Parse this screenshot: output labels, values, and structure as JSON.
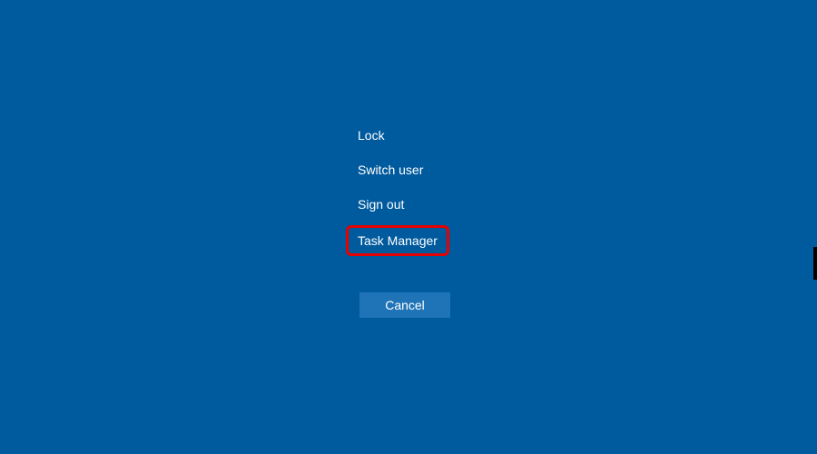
{
  "menu": {
    "items": [
      {
        "label": "Lock"
      },
      {
        "label": "Switch user"
      },
      {
        "label": "Sign out"
      },
      {
        "label": "Task Manager"
      }
    ]
  },
  "cancel": {
    "label": "Cancel"
  },
  "colors": {
    "background": "#005a9e",
    "button": "#1f74b8",
    "highlight_border": "#e60000",
    "text": "#ffffff"
  },
  "highlighted_index": 3
}
